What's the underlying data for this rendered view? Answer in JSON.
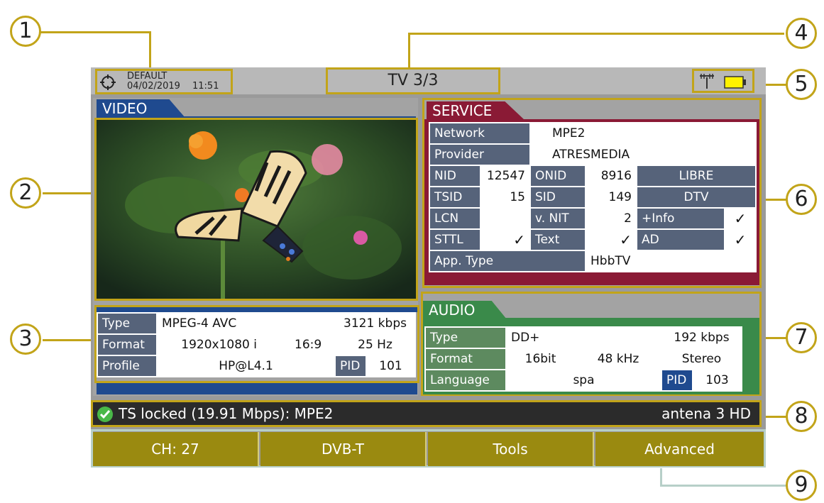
{
  "callouts": [
    "1",
    "2",
    "3",
    "4",
    "5",
    "6",
    "7",
    "8",
    "9"
  ],
  "statusbar": {
    "profile": "DEFAULT",
    "date": "04/02/2019",
    "time": "11:51",
    "title": "TV 3/3",
    "icons": [
      "target-icon",
      "antenna-icon",
      "battery-icon"
    ]
  },
  "video": {
    "title": "VIDEO",
    "image": "butterfly-on-flowers",
    "rows": {
      "type_label": "Type",
      "type_value": "MPEG-4 AVC",
      "bitrate": "3121 kbps",
      "format_label": "Format",
      "resolution": "1920x1080 i",
      "aspect": "16:9",
      "frequency": "25 Hz",
      "profile_label": "Profile",
      "profile_value": "HP@L4.1",
      "pid_label": "PID",
      "pid_value": "101"
    }
  },
  "service": {
    "title": "SERVICE",
    "network_label": "Network",
    "network_value": "MPE2",
    "provider_label": "Provider",
    "provider_value": "ATRESMEDIA",
    "nid_label": "NID",
    "nid_value": "12547",
    "onid_label": "ONID",
    "onid_value": "8916",
    "access": "LIBRE",
    "tsid_label": "TSID",
    "tsid_value": "15",
    "sid_label": "SID",
    "sid_value": "149",
    "service_type": "DTV",
    "lcn_label": "LCN",
    "lcn_value": "",
    "vnit_label": "v. NIT",
    "vnit_value": "2",
    "info_label": "+Info",
    "info_check": "✓",
    "sttl_label": "STTL",
    "sttl_check": "✓",
    "text_label": "Text",
    "text_check": "✓",
    "ad_label": "AD",
    "ad_check": "✓",
    "app_label": "App. Type",
    "app_value": "HbbTV"
  },
  "audio": {
    "title": "AUDIO",
    "type_label": "Type",
    "type_value": "DD+",
    "bitrate": "192 kbps",
    "format_label": "Format",
    "bits": "16bit",
    "rate": "48 kHz",
    "channels": "Stereo",
    "language_label": "Language",
    "language_value": "spa",
    "pid_label": "PID",
    "pid_value": "103"
  },
  "status": {
    "lock_text": "TS locked (19.91 Mbps): MPE2",
    "channel_name": "antena 3 HD",
    "lock_icon": "check-circle-icon"
  },
  "softkeys": [
    "CH: 27",
    "DVB-T",
    "Tools",
    "Advanced"
  ],
  "colors": {
    "callout": "#c2a419",
    "service": "#8a1a35",
    "video": "#1f4a8f",
    "audio": "#3a8a4a"
  }
}
